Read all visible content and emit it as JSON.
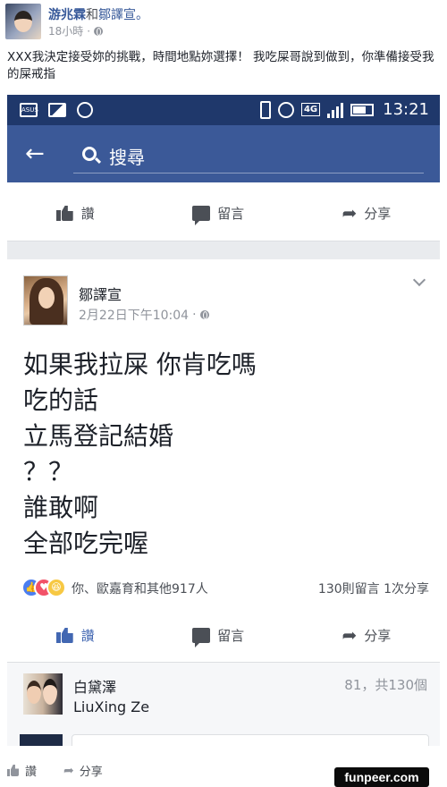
{
  "post": {
    "author": "游兆霖",
    "connector": "和",
    "tagged": "鄒譯宣。",
    "time": "18小時",
    "separator": "·",
    "text": "XXX我決定接受妳的挑戰，時間地點妳選擇！ 我吃屎哥說到做到，你準備接受我的屎戒指"
  },
  "screenshot": {
    "statusbar": {
      "asus_label": "ASUS",
      "network": "4G",
      "time": "13:21"
    },
    "search": {
      "placeholder": "搜尋"
    },
    "actions": {
      "like": "讚",
      "comment": "留言",
      "share": "分享"
    },
    "inner_post": {
      "author": "鄒譯宣",
      "date": "2月22日下午10:04",
      "separator": "·",
      "body": "如果我拉屎 你肯吃嗎\n吃的話\n立馬登記結婚\n？？\n誰敢啊\n全部吃完喔",
      "reactions_text": "你、歐嘉育和其他917人",
      "counts_text": "130則留言 1次分享"
    },
    "comment": {
      "name": "白黛澤",
      "sub": "LiuXing Ze",
      "count": "81，共130個"
    }
  },
  "footer": {
    "like": "讚",
    "share": "分享",
    "watermark": "funpeer.com"
  }
}
